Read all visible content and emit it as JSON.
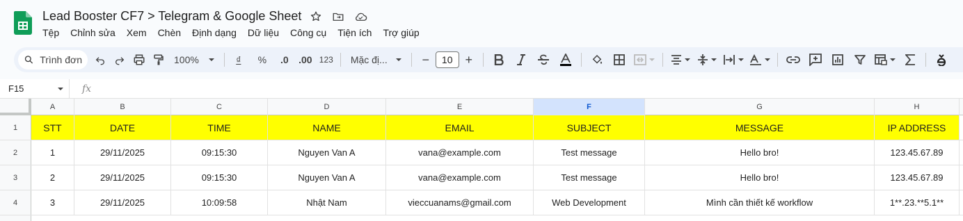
{
  "doc": {
    "title": "Lead Booster CF7 > Telegram & Google Sheet"
  },
  "menu": [
    "Tệp",
    "Chỉnh sửa",
    "Xem",
    "Chèn",
    "Định dạng",
    "Dữ liệu",
    "Công cụ",
    "Tiện ích",
    "Trợ giúp"
  ],
  "toolbar": {
    "search_label": "Trình đơn",
    "zoom": "100%",
    "currency": "₫",
    "percent": "%",
    "dec_decrease": ".0",
    "dec_increase": ".00",
    "number_format": "123",
    "font": "Mặc đị...",
    "font_size": "10",
    "minus": "−",
    "plus": "+"
  },
  "formula_bar": {
    "cell_ref": "F15",
    "fx": "fx"
  },
  "columns": [
    "A",
    "B",
    "C",
    "D",
    "E",
    "F",
    "G",
    "H"
  ],
  "selected_column": "F",
  "rows": [
    {
      "num": "1",
      "cells": [
        "STT",
        "DATE",
        "TIME",
        "NAME",
        "EMAIL",
        "SUBJECT",
        "MESSAGE",
        "IP ADDRESS"
      ]
    },
    {
      "num": "2",
      "cells": [
        "1",
        "29/11/2025",
        "09:15:30",
        "Nguyen Van A",
        "vana@example.com",
        "Test message",
        "Hello bro!",
        "123.45.67.89"
      ]
    },
    {
      "num": "3",
      "cells": [
        "2",
        "29/11/2025",
        "09:15:30",
        "Nguyen Van A",
        "vana@example.com",
        "Test message",
        "Hello bro!",
        "123.45.67.89"
      ]
    },
    {
      "num": "4",
      "cells": [
        "3",
        "29/11/2025",
        "10:09:58",
        "Nhật Nam",
        "vieccuanams@gmail.com",
        "Web Development",
        "Mình cần thiết kế workflow",
        "1**.23.**5.1**"
      ]
    }
  ],
  "colors": {
    "header_fill": "#ffff00",
    "selected_col": "#d3e3fd",
    "sheets_green": "#0f9d58"
  }
}
